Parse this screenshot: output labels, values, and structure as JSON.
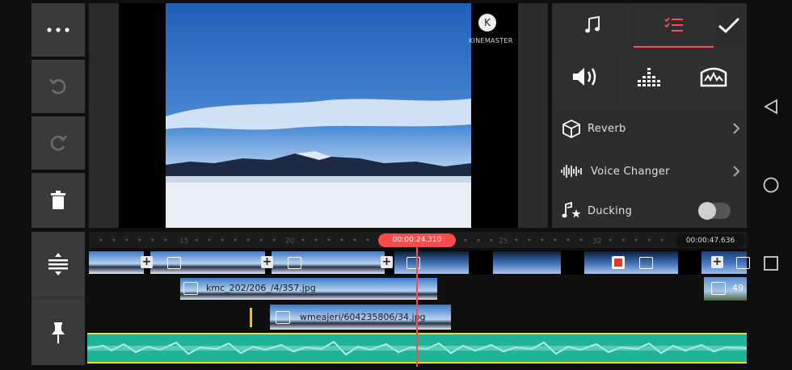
{
  "preview": {
    "watermark": {
      "text": "KINEMASTER",
      "logo_letter": "K"
    }
  },
  "left_toolbar": {
    "items": [
      {
        "name": "more-icon"
      },
      {
        "name": "undo-icon"
      },
      {
        "name": "redo-icon"
      },
      {
        "name": "trash-icon"
      }
    ]
  },
  "panel": {
    "tabs": [
      {
        "name": "music-icon"
      },
      {
        "name": "checklist-icon",
        "active": true,
        "accent": "#ff4d4d"
      },
      {
        "name": "check-icon"
      }
    ],
    "icon_row": [
      "volume-icon",
      "equalizer-icon",
      "audio-filter-icon"
    ],
    "options": [
      {
        "label": "Reverb",
        "icon": "cube-icon",
        "has_chevron": true
      },
      {
        "label": "Voice Changer",
        "icon": "waveform-icon",
        "has_chevron": true
      },
      {
        "label": "Ducking",
        "icon": "music-star-icon",
        "toggle": false
      }
    ]
  },
  "timeline": {
    "playhead_time": "00:00:24.310",
    "total_time": "00:00:47.636",
    "ruler_ticks": [
      "15",
      "20",
      "25",
      "32"
    ],
    "layer_clips": [
      {
        "label": "kmc_202/206_/4/357.jpg"
      },
      {
        "label": "wmeajeri/604235806/34.jpg"
      }
    ],
    "overflow_label": "49",
    "colors": {
      "playhead": "#ff4a4a",
      "audio": "#1fb39a",
      "audio_border": "#f2dc2b"
    }
  },
  "nav_bar": [
    "back-icon",
    "home-icon",
    "recents-icon"
  ]
}
